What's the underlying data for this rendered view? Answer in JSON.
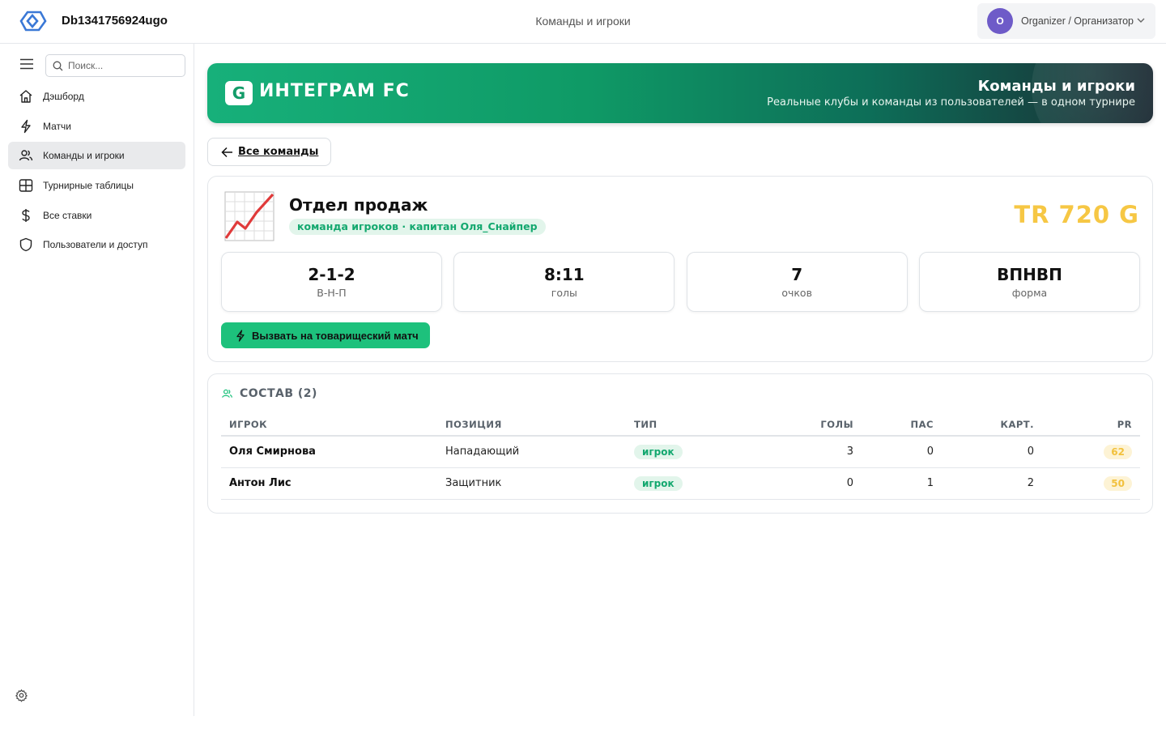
{
  "header": {
    "app_title": "Db1341756924ugo",
    "page_title": "Команды и игроки",
    "user": {
      "initial": "O",
      "name": "Organizer / Организатор"
    }
  },
  "sidebar": {
    "search_placeholder": "Поиск...",
    "items": [
      {
        "label": "Дэшборд",
        "icon": "home-icon"
      },
      {
        "label": "Матчи",
        "icon": "lightning-icon"
      },
      {
        "label": "Команды и игроки",
        "icon": "users-icon",
        "active": true
      },
      {
        "label": "Турнирные таблицы",
        "icon": "table-icon"
      },
      {
        "label": "Все ставки",
        "icon": "dollar-icon"
      },
      {
        "label": "Пользователи и доступ",
        "icon": "shield-icon"
      }
    ]
  },
  "hero": {
    "logo_letter": "G",
    "brand": "ИНТЕГРАМ FC",
    "title": "Команды и игроки",
    "subtitle": "Реальные клубы и команды из пользователей — в одном турнире"
  },
  "back_button": {
    "label": "Все команды"
  },
  "team": {
    "name": "Отдел продаж",
    "tag": "команда игроков · капитан Оля_Снайпер",
    "balance": "TR 720 G",
    "stats": [
      {
        "value": "2-1-2",
        "label": "В-Н-П"
      },
      {
        "value": "8:11",
        "label": "голы"
      },
      {
        "value": "7",
        "label": "очков"
      },
      {
        "value": "ВПНВП",
        "label": "форма"
      }
    ],
    "challenge_label": "Вызвать на товарищеский матч"
  },
  "roster": {
    "title": "СОСТАВ (2)",
    "columns": [
      "ИГРОК",
      "ПОЗИЦИЯ",
      "ТИП",
      "ГОЛЫ",
      "ПАС",
      "КАРТ.",
      "PR"
    ],
    "rows": [
      {
        "player": "Оля Смирнова",
        "position": "Нападающий",
        "type": "игрок",
        "goals": "3",
        "assists": "0",
        "cards": "0",
        "pr": "62"
      },
      {
        "player": "Антон Лис",
        "position": "Защитник",
        "type": "игрок",
        "goals": "0",
        "assists": "1",
        "cards": "2",
        "pr": "50"
      }
    ]
  },
  "colors": {
    "accent_green": "#1dc17c",
    "balance_gold": "#f6c744",
    "avatar_purple": "#6e5bc8"
  }
}
